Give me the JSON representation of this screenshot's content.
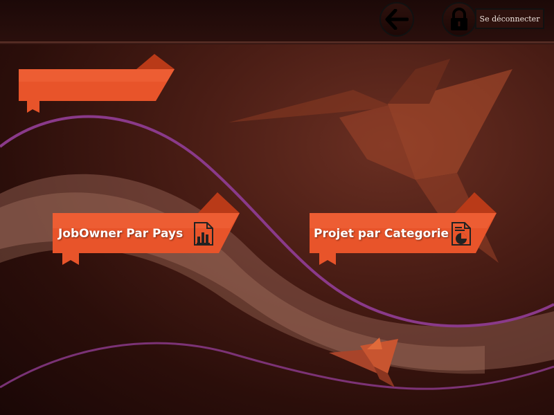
{
  "header": {
    "back_icon": "arrow-left-icon",
    "lock_icon": "lock-icon",
    "logout_label": "Se déconnecter"
  },
  "main": {
    "title_ribbon": {
      "label": ""
    },
    "buttons": [
      {
        "label": "JobOwner Par Pays",
        "icon": "bar-chart-document-icon"
      },
      {
        "label": "Projet par Categorie",
        "icon": "pie-chart-document-icon"
      }
    ]
  },
  "colors": {
    "ribbon": "#e8542a",
    "ribbon_dark": "#b93a18",
    "accent_wave": "#8a3a8a",
    "background": "#4a1d15"
  }
}
